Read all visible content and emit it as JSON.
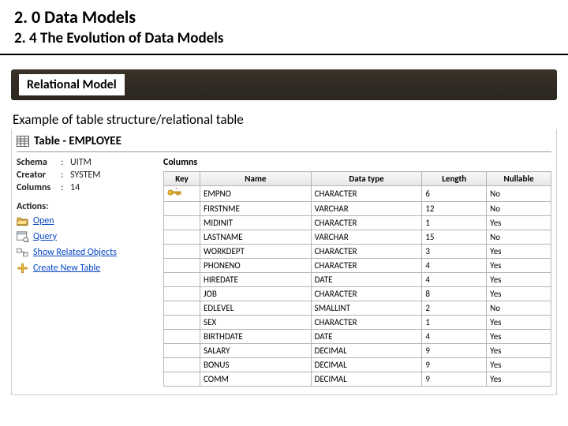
{
  "header": {
    "line1": "2. 0 Data Models",
    "line2": "2. 4 The Evolution of Data Models"
  },
  "banner": {
    "title": "Relational Model"
  },
  "example_label": "Example of  table structure/relational table",
  "table_header": {
    "prefix": "Table - ",
    "name": "EMPLOYEE"
  },
  "meta": {
    "schema_label": "Schema",
    "schema_value": "UITM",
    "creator_label": "Creator",
    "creator_value": "SYSTEM",
    "columns_label": "Columns",
    "columns_value": "14"
  },
  "actions": {
    "heading": "Actions:",
    "open": "Open",
    "query": "Query",
    "related": "Show Related Objects",
    "create": "Create New Table"
  },
  "columns_section": {
    "heading": "Columns",
    "headers": {
      "key": "Key",
      "name": "Name",
      "datatype": "Data type",
      "length": "Length",
      "nullable": "Nullable"
    },
    "rows": [
      {
        "key": true,
        "name": "EMPNO",
        "datatype": "CHARACTER",
        "length": "6",
        "nullable": "No"
      },
      {
        "key": false,
        "name": "FIRSTNME",
        "datatype": "VARCHAR",
        "length": "12",
        "nullable": "No"
      },
      {
        "key": false,
        "name": "MIDINIT",
        "datatype": "CHARACTER",
        "length": "1",
        "nullable": "Yes"
      },
      {
        "key": false,
        "name": "LASTNAME",
        "datatype": "VARCHAR",
        "length": "15",
        "nullable": "No"
      },
      {
        "key": false,
        "name": "WORKDEPT",
        "datatype": "CHARACTER",
        "length": "3",
        "nullable": "Yes"
      },
      {
        "key": false,
        "name": "PHONENO",
        "datatype": "CHARACTER",
        "length": "4",
        "nullable": "Yes"
      },
      {
        "key": false,
        "name": "HIREDATE",
        "datatype": "DATE",
        "length": "4",
        "nullable": "Yes"
      },
      {
        "key": false,
        "name": "JOB",
        "datatype": "CHARACTER",
        "length": "8",
        "nullable": "Yes"
      },
      {
        "key": false,
        "name": "EDLEVEL",
        "datatype": "SMALLINT",
        "length": "2",
        "nullable": "No"
      },
      {
        "key": false,
        "name": "SEX",
        "datatype": "CHARACTER",
        "length": "1",
        "nullable": "Yes"
      },
      {
        "key": false,
        "name": "BIRTHDATE",
        "datatype": "DATE",
        "length": "4",
        "nullable": "Yes"
      },
      {
        "key": false,
        "name": "SALARY",
        "datatype": "DECIMAL",
        "length": "9",
        "nullable": "Yes"
      },
      {
        "key": false,
        "name": "BONUS",
        "datatype": "DECIMAL",
        "length": "9",
        "nullable": "Yes"
      },
      {
        "key": false,
        "name": "COMM",
        "datatype": "DECIMAL",
        "length": "9",
        "nullable": "Yes"
      }
    ]
  }
}
